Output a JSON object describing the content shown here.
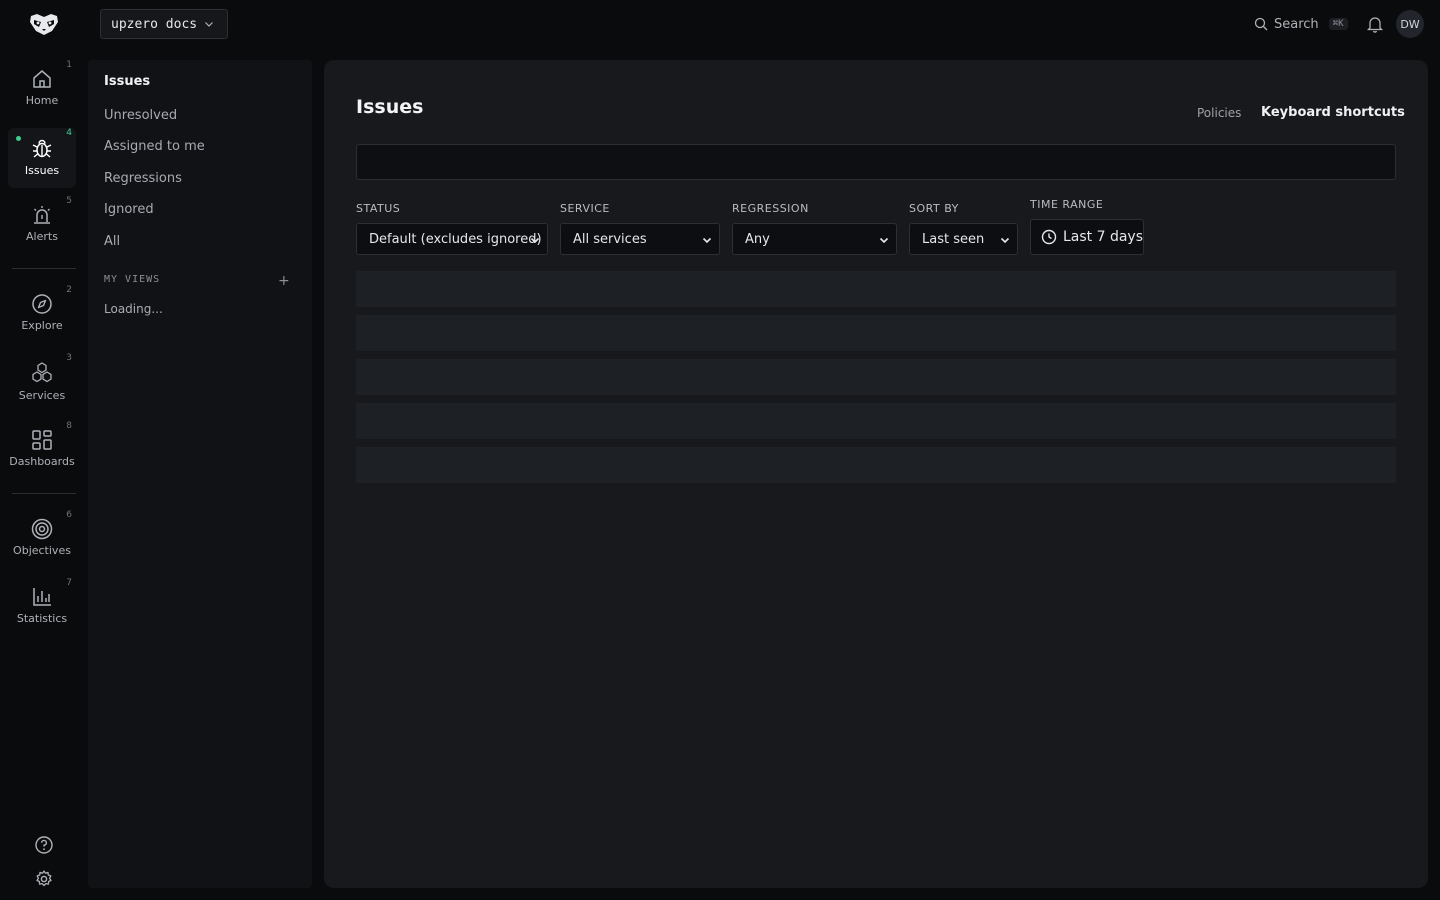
{
  "topbar": {
    "project_name": "upzero docs",
    "search_label": "Search",
    "search_shortcut": "⌘K",
    "avatar_initials": "DW"
  },
  "rail": {
    "items": [
      {
        "label": "Home",
        "shortcut": "1",
        "icon": "home-icon"
      },
      {
        "label": "Issues",
        "shortcut": "4",
        "icon": "bug-icon",
        "active": true
      },
      {
        "label": "Alerts",
        "shortcut": "5",
        "icon": "siren-icon"
      },
      {
        "label": "Explore",
        "shortcut": "2",
        "icon": "compass-icon"
      },
      {
        "label": "Services",
        "shortcut": "3",
        "icon": "cubes-icon"
      },
      {
        "label": "Dashboards",
        "shortcut": "8",
        "icon": "grid-icon"
      },
      {
        "label": "Objectives",
        "shortcut": "6",
        "icon": "target-icon"
      },
      {
        "label": "Statistics",
        "shortcut": "7",
        "icon": "bar-chart-icon"
      }
    ],
    "accent_color": "#3ecf8e"
  },
  "subnav": {
    "title": "Issues",
    "links": [
      "Unresolved",
      "Assigned to me",
      "Regressions",
      "Ignored",
      "All"
    ],
    "section_title": "MY VIEWS",
    "add_symbol": "+",
    "loading_text": "Loading..."
  },
  "main": {
    "title": "Issues",
    "policies_label": "Policies",
    "shortcuts_label": "Keyboard shortcuts",
    "search_value": "",
    "filters": {
      "status": {
        "label": "STATUS",
        "value": "Default (excludes ignored)"
      },
      "service": {
        "label": "SERVICE",
        "value": "All services"
      },
      "regression": {
        "label": "REGRESSION",
        "value": "Any"
      },
      "sort_by": {
        "label": "SORT BY",
        "value": "Last seen"
      },
      "time_range": {
        "label": "TIME RANGE",
        "value": "Last 7 days"
      }
    }
  }
}
